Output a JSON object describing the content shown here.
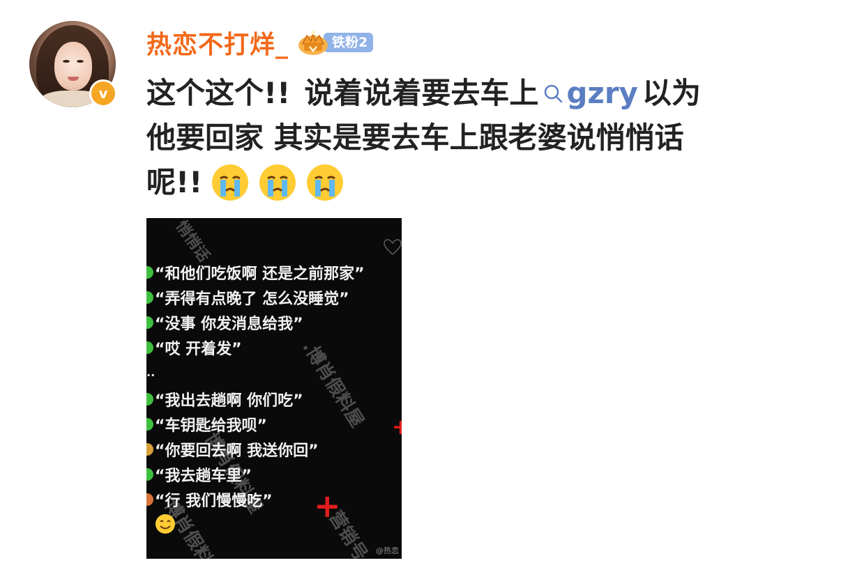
{
  "post": {
    "username": "热恋不打烊_",
    "fan_badge": "铁粉2",
    "verified_badge": "v",
    "text_lines": [
      [
        "这个这个!!",
        "说着说着要去车上"
      ],
      [
        "他要回家 其实是要去车上跟老婆说悄悄话"
      ],
      [
        "呢!!"
      ]
    ],
    "topic": "gzry",
    "after_topic": "以为",
    "emojis": [
      "crying-face-icon",
      "crying-face-icon",
      "crying-face-icon"
    ]
  },
  "image": {
    "top_watermark": "悄悄话",
    "chat_lines": [
      "“和他们吃饭啊 还是之前那家”",
      "“弄得有点晚了 怎么没睡觉”",
      "“没事 你发消息给我”",
      "“哎 开着发”",
      "..",
      "“我出去趟啊 你们吃”",
      "“车钥匙给我呗”",
      "“你要回去啊 我送你回”",
      "“我去趟车里”",
      "“行 我们慢慢吃”"
    ],
    "watermark_1": ".博肖假料屋",
    "watermark_2": "博肖假料屋",
    "watermark_3": "营销号",
    "watermark_4": "博肖假料",
    "credit": "@热恋"
  },
  "colors": {
    "username": "#f2691a",
    "topic": "#5b7ec2",
    "fan_pill": "#8fb2e8",
    "verified": "#f5a623"
  }
}
